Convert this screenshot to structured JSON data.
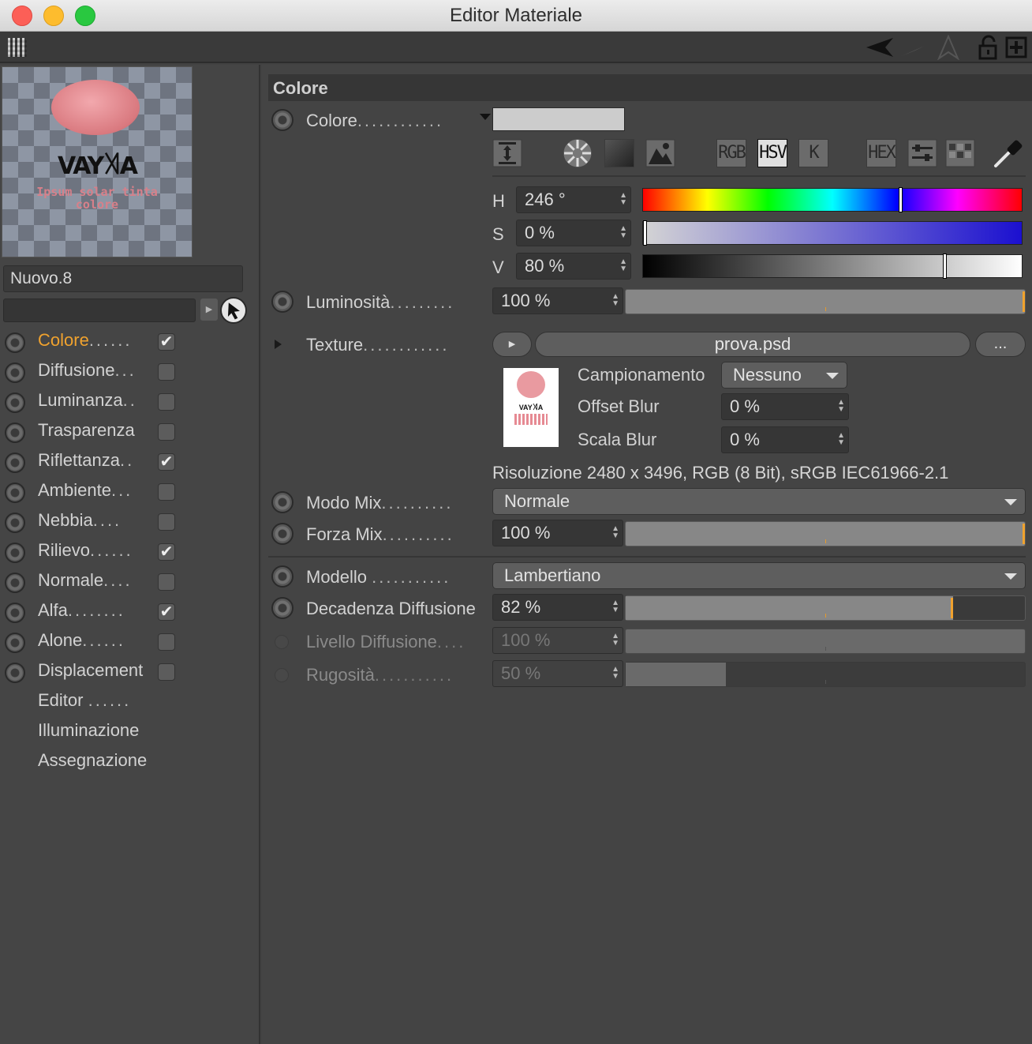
{
  "window": {
    "title": "Editor Materiale"
  },
  "preview": {
    "logo_text": "VAY꓀A",
    "texture_text": "Ipsum solar tinta colore"
  },
  "material": {
    "name": "Nuovo.8"
  },
  "channels": [
    {
      "label": "Colore",
      "dots": "......",
      "checked": "✔",
      "active": true
    },
    {
      "label": "Diffusione",
      "dots": "...",
      "checked": ""
    },
    {
      "label": "Luminanza",
      "dots": "..",
      "checked": ""
    },
    {
      "label": "Trasparenza",
      "dots": "",
      "checked": ""
    },
    {
      "label": "Riflettanza",
      "dots": "..",
      "checked": "✔"
    },
    {
      "label": "Ambiente",
      "dots": "...",
      "checked": ""
    },
    {
      "label": "Nebbia",
      "dots": "....",
      "checked": ""
    },
    {
      "label": "Rilievo",
      "dots": "......",
      "checked": "✔"
    },
    {
      "label": "Normale",
      "dots": "....",
      "checked": ""
    },
    {
      "label": "Alfa",
      "dots": "........",
      "checked": "✔"
    },
    {
      "label": "Alone",
      "dots": "......",
      "checked": ""
    },
    {
      "label": "Displacement",
      "dots": "",
      "checked": ""
    }
  ],
  "extra_items": [
    {
      "label": "Editor",
      "dots": "......"
    },
    {
      "label": "Illuminazione",
      "dots": ""
    },
    {
      "label": "Assegnazione",
      "dots": ""
    }
  ],
  "section": {
    "title": "Colore"
  },
  "colore": {
    "label": "Colore",
    "dots": "............",
    "swatch": "#cccccc"
  },
  "color_modes": [
    "RGB",
    "HSV",
    "K",
    "HEX"
  ],
  "hsv": {
    "h": {
      "label": "H",
      "value": "246 °",
      "fraction": 0.683
    },
    "s": {
      "label": "S",
      "value": "0 %",
      "fraction": 0.0
    },
    "v": {
      "label": "V",
      "value": "80 %",
      "fraction": 0.8
    }
  },
  "luminosita": {
    "label": "Luminosità",
    "dots": ".........",
    "value": "100 %"
  },
  "texture": {
    "label": "Texture",
    "dots": "............",
    "file": "prova.psd",
    "more": "...",
    "campionamento_label": "Campionamento",
    "campionamento_value": "Nessuno",
    "offset_label": "Offset Blur",
    "offset_value": "0 %",
    "scala_label": "Scala Blur",
    "scala_value": "0 %",
    "info": "Risoluzione 2480 x 3496, RGB (8 Bit), sRGB IEC61966-2.1"
  },
  "modo_mix": {
    "label": "Modo Mix",
    "dots": "..........",
    "value": "Normale"
  },
  "forza_mix": {
    "label": "Forza Mix",
    "dots": "..........",
    "value": "100 %"
  },
  "modello": {
    "label": "Modello",
    "dots": "...........",
    "value": "Lambertiano"
  },
  "decadenza": {
    "label": "Decadenza Diffusione",
    "value": "82 %",
    "fraction": 0.82
  },
  "livello": {
    "label": "Livello Diffusione",
    "dots": "....",
    "value": "100 %"
  },
  "rugosita": {
    "label": "Rugosità",
    "dots": "...........",
    "value": "50 %",
    "fraction": 0.25
  }
}
